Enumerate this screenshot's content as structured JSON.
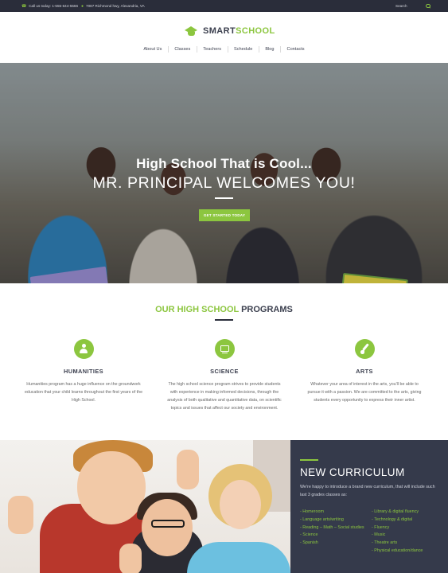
{
  "topbar": {
    "phone": "Call us today: 1-555-644-5566",
    "address": "7087 Richmond hwy, Alexandria, VA",
    "search_placeholder": "Search"
  },
  "header": {
    "logo_part1": "SMART",
    "logo_part2": "SCHOOL"
  },
  "nav": {
    "items": [
      "About Us",
      "Classes",
      "Teachers",
      "Schedule",
      "Blog",
      "Contacts"
    ]
  },
  "hero": {
    "title": "High School That is Cool...",
    "subtitle": "MR. PRINCIPAL WELCOMES YOU!",
    "button": "GET STARTED TODAY"
  },
  "programs": {
    "title_strong": "OUR HIGH SCHOOL",
    "title_rest": " PROGRAMS",
    "items": [
      {
        "icon": "person-icon",
        "title": "HUMANITIES",
        "text": "Humanities program has a huge influence on the groundwork education that your child learns throughout the first years of the High School."
      },
      {
        "icon": "monitor-icon",
        "title": "SCIENCE",
        "text": "The high school science program strives to provide students with experience in making informed decisions, through the analysis of both qualitative and quantitative data, on scientific topics and issues that affect our society and environment."
      },
      {
        "icon": "brush-icon",
        "title": "ARTS",
        "text": "Whatever your area of interest in the arts, you'll be able to pursue it with a passion. We are committed to the arts, giving students every opportunity to express their inner artist."
      }
    ]
  },
  "curriculum": {
    "title": "NEW CURRICULUM",
    "intro": "We're happy to introduce a brand new curriculum, that will include such last 3 grades classes as:",
    "col1": [
      "- Homeroom",
      "- Language arts/writing",
      "- Reading – Math – Social studies",
      "- Science",
      "- Spanish"
    ],
    "col2": [
      "- Library & digital fluency",
      "- Technology & digital",
      "- Fluency",
      "- Music",
      "- Theatre arts",
      "- Physical education/dance"
    ]
  },
  "colors": {
    "accent": "#8cc63f",
    "dark": "#2a2d3a",
    "panel": "#353a4b"
  }
}
